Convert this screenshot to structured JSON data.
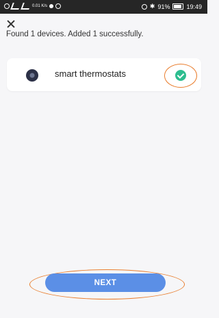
{
  "status_bar": {
    "carrier_icons": [
      "sim-icon",
      "signal-icon",
      "wifi-icon"
    ],
    "speed": "0.01 K/s",
    "icons_right": [
      "alarm-icon",
      "bluetooth-icon"
    ],
    "battery": "91%",
    "time": "19:49"
  },
  "header": {
    "close_icon": "close-icon"
  },
  "result_message": "Found 1 devices. Added 1 successfully.",
  "device": {
    "name": "smart thermostats",
    "icon": "thermostat-icon",
    "status_icon": "check-circle-icon",
    "status_color": "#2dbd8f"
  },
  "footer": {
    "next_label": "NEXT",
    "next_color": "#5b8fe6",
    "highlight_color": "#e97d2d"
  }
}
